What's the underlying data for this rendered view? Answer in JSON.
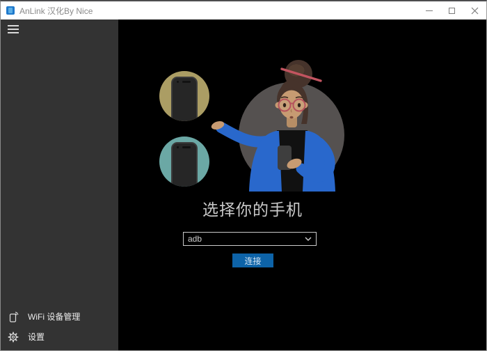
{
  "window": {
    "title": "AnLink 汉化By Nice"
  },
  "titlebar": {
    "icons": {
      "app": "blue-phone-app-icon",
      "minimize": "─",
      "maximize": "▢",
      "close": "✕"
    }
  },
  "sidebar": {
    "menu_icon": "hamburger ≡",
    "items": [
      {
        "id": "wifi-manager",
        "icon": "phone-wifi-icon",
        "label": "WiFi 设备管理"
      },
      {
        "id": "settings",
        "icon": "gear-icon",
        "label": "设置"
      }
    ]
  },
  "main": {
    "heading": "选择你的手机",
    "device_select": {
      "value": "adb",
      "chevron_icon": "˅"
    },
    "connect_button": "连接"
  },
  "colors": {
    "accent_blue": "#0d63a8",
    "gold_circle": "#ab9d64",
    "teal_circle": "#6ba8a5",
    "illustration_gray": "#555150",
    "jacket_blue": "#2968cc",
    "skin": "#c79b72",
    "hair": "#46332b",
    "titlebar_bg": "#ffffff",
    "sidebar_bg": "#333333",
    "main_bg": "#000000"
  }
}
